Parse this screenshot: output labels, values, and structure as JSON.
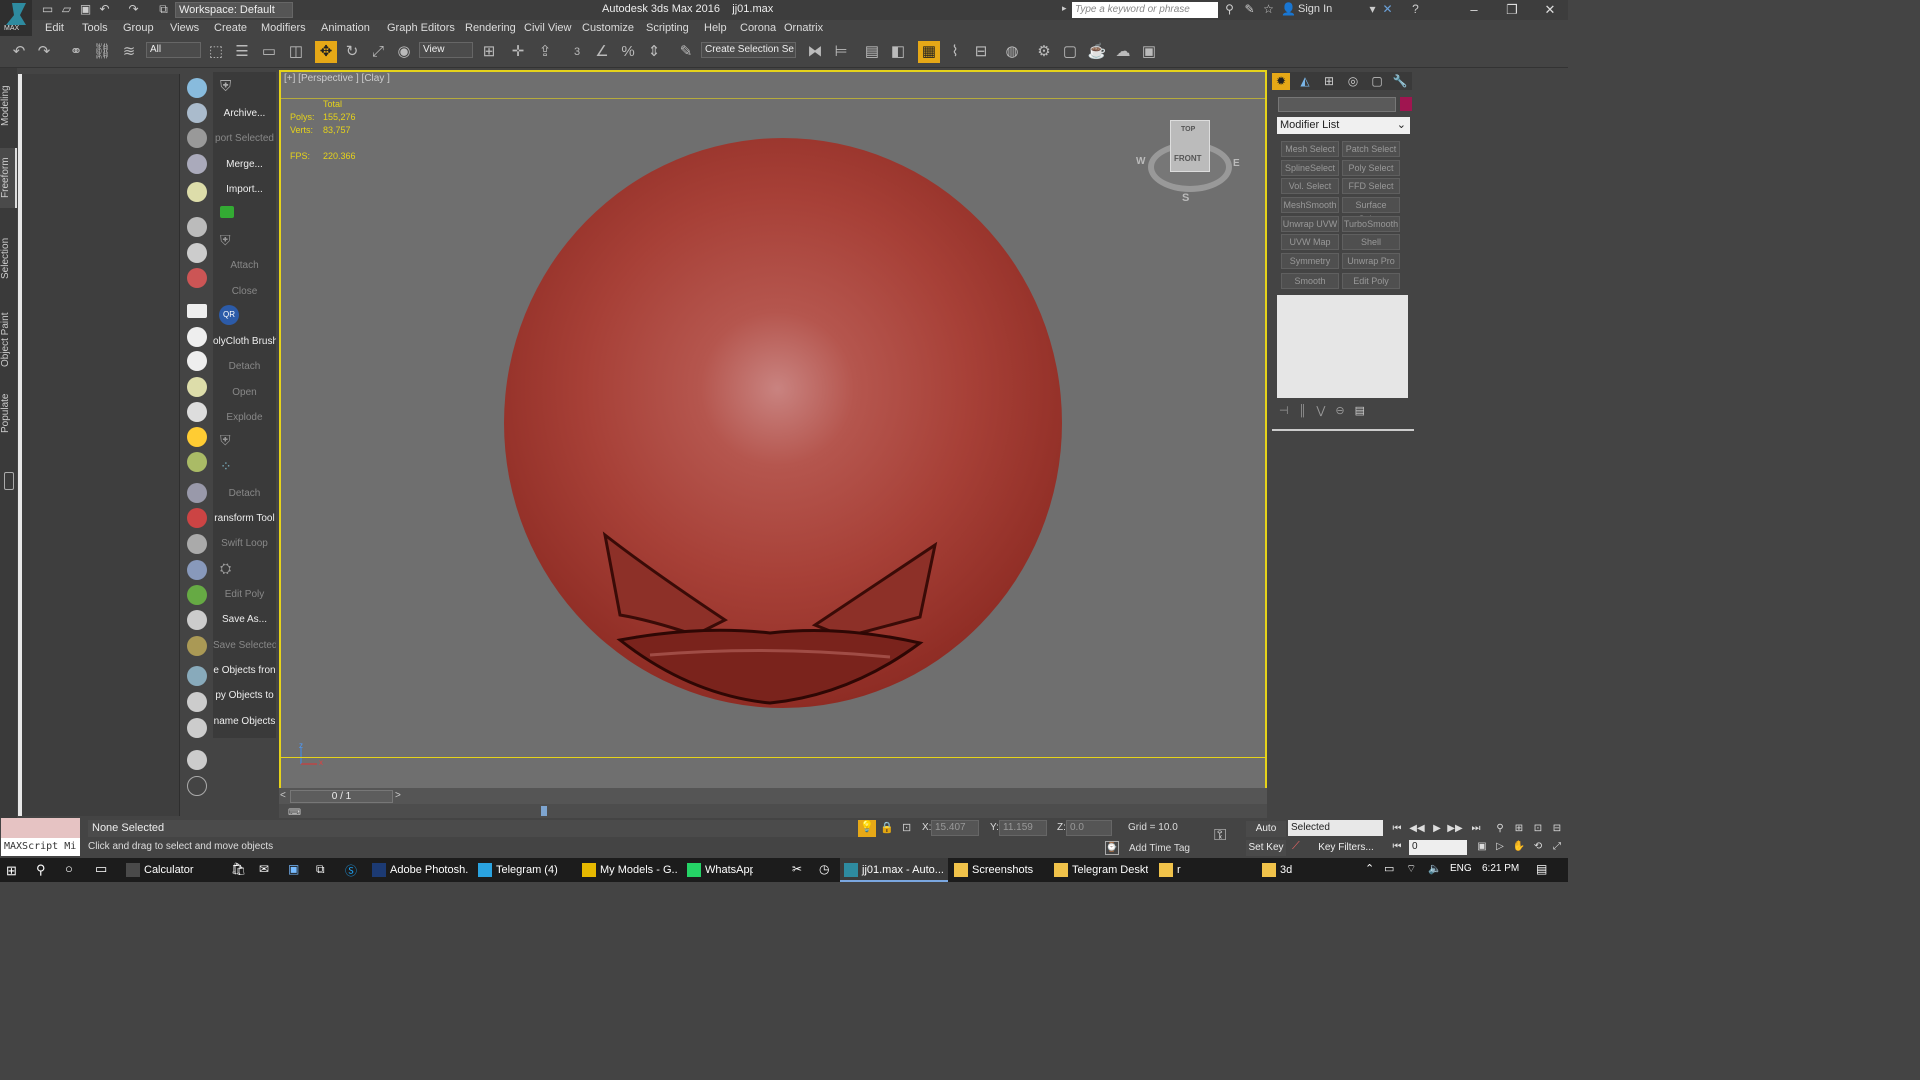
{
  "app": {
    "title": "Autodesk 3ds Max 2016",
    "file": "jj01.max",
    "logo_text": "MAX",
    "workspace": "Workspace: Default",
    "search_placeholder": "Type a keyword or phrase",
    "sign_in": "Sign In"
  },
  "menu": [
    "Edit",
    "Tools",
    "Group",
    "Views",
    "Create",
    "Modifiers",
    "Animation",
    "Graph Editors",
    "Rendering",
    "Civil View",
    "Customize",
    "Scripting",
    "Help",
    "Corona",
    "Ornatrix"
  ],
  "toolbar": {
    "filter": "All",
    "coord_system": "View",
    "selection_set": "Create Selection Se",
    "snap_label": "3"
  },
  "ribbon_tabs": [
    "Modeling",
    "Freeform",
    "Selection",
    "Object Paint",
    "Populate"
  ],
  "script_panel": [
    {
      "label": "Archive...",
      "enabled": true
    },
    {
      "label": "port Selected",
      "enabled": false
    },
    {
      "label": "Merge...",
      "enabled": true
    },
    {
      "label": "Import...",
      "enabled": true
    },
    {
      "label": "Attach",
      "enabled": false
    },
    {
      "label": "Close",
      "enabled": false
    },
    {
      "label": "olyCloth Brush",
      "enabled": true
    },
    {
      "label": "Detach",
      "enabled": false
    },
    {
      "label": "Open",
      "enabled": false
    },
    {
      "label": "Explode",
      "enabled": false
    },
    {
      "label": "Detach",
      "enabled": false
    },
    {
      "label": "ransform Tool",
      "enabled": true
    },
    {
      "label": "Swift Loop",
      "enabled": false
    },
    {
      "label": "Edit Poly",
      "enabled": false
    },
    {
      "label": "Save As...",
      "enabled": true
    },
    {
      "label": "Save Selected",
      "enabled": false
    },
    {
      "label": "e Objects fron",
      "enabled": true
    },
    {
      "label": "py Objects to",
      "enabled": true
    },
    {
      "label": "name Objects",
      "enabled": true
    }
  ],
  "viewport": {
    "label": "[+] [Perspective ] [Clay ]",
    "stats": {
      "total_label": "Total",
      "polys_label": "Polys:",
      "polys": "155,276",
      "verts_label": "Verts:",
      "verts": "83,757",
      "fps_label": "FPS:",
      "fps": "220.366"
    },
    "viewcube": {
      "top": "TOP",
      "front": "FRONT",
      "w": "W",
      "e": "E",
      "s": "S"
    },
    "axis": {
      "z": "z",
      "x": "x"
    }
  },
  "timeline": {
    "frame": "0 / 1",
    "prev": "<",
    "next": ">"
  },
  "command_panel": {
    "modifier_list": "Modifier List",
    "buttons": [
      "Mesh Select",
      "Patch Select",
      "SplineSelect",
      "Poly Select",
      "Vol. Select",
      "FFD Select",
      "MeshSmooth",
      "Surface Select",
      "Unwrap UVW",
      "TurboSmooth",
      "UVW Map",
      "Shell",
      "Symmetry",
      "Unwrap Pro",
      "Smooth",
      "Edit Poly"
    ],
    "color_swatch": "#a01550"
  },
  "status": {
    "maxscript": "MAXScript Mi",
    "selection": "None Selected",
    "prompt": "Click and drag to select and move objects",
    "x_label": "X:",
    "x": "15.407",
    "y_label": "Y:",
    "y": "11.159",
    "z_label": "Z:",
    "z": "0.0",
    "grid": "Grid = 10.0",
    "add_time_tag": "Add Time Tag",
    "auto_key": "Auto Key",
    "set_key": "Set Key",
    "selected": "Selected",
    "key_filters": "Key Filters...",
    "frame": "0"
  },
  "taskbar": {
    "items": [
      {
        "label": "Calculator",
        "active": false
      },
      {
        "label": "Adobe Photosh...",
        "active": false
      },
      {
        "label": "Telegram (4)",
        "active": false
      },
      {
        "label": "My Models - G...",
        "active": false
      },
      {
        "label": "WhatsApp",
        "active": false
      },
      {
        "label": "jj01.max - Auto...",
        "active": true
      },
      {
        "label": "Screenshots",
        "active": false
      },
      {
        "label": "Telegram Deskt...",
        "active": false
      },
      {
        "label": "r",
        "active": false
      },
      {
        "label": "3d",
        "active": false
      }
    ],
    "language": "ENG",
    "time": "6:21 PM"
  },
  "colors": {
    "accent": "#e6a817",
    "viewport_border": "#e6d31a",
    "object": "#a74037"
  }
}
